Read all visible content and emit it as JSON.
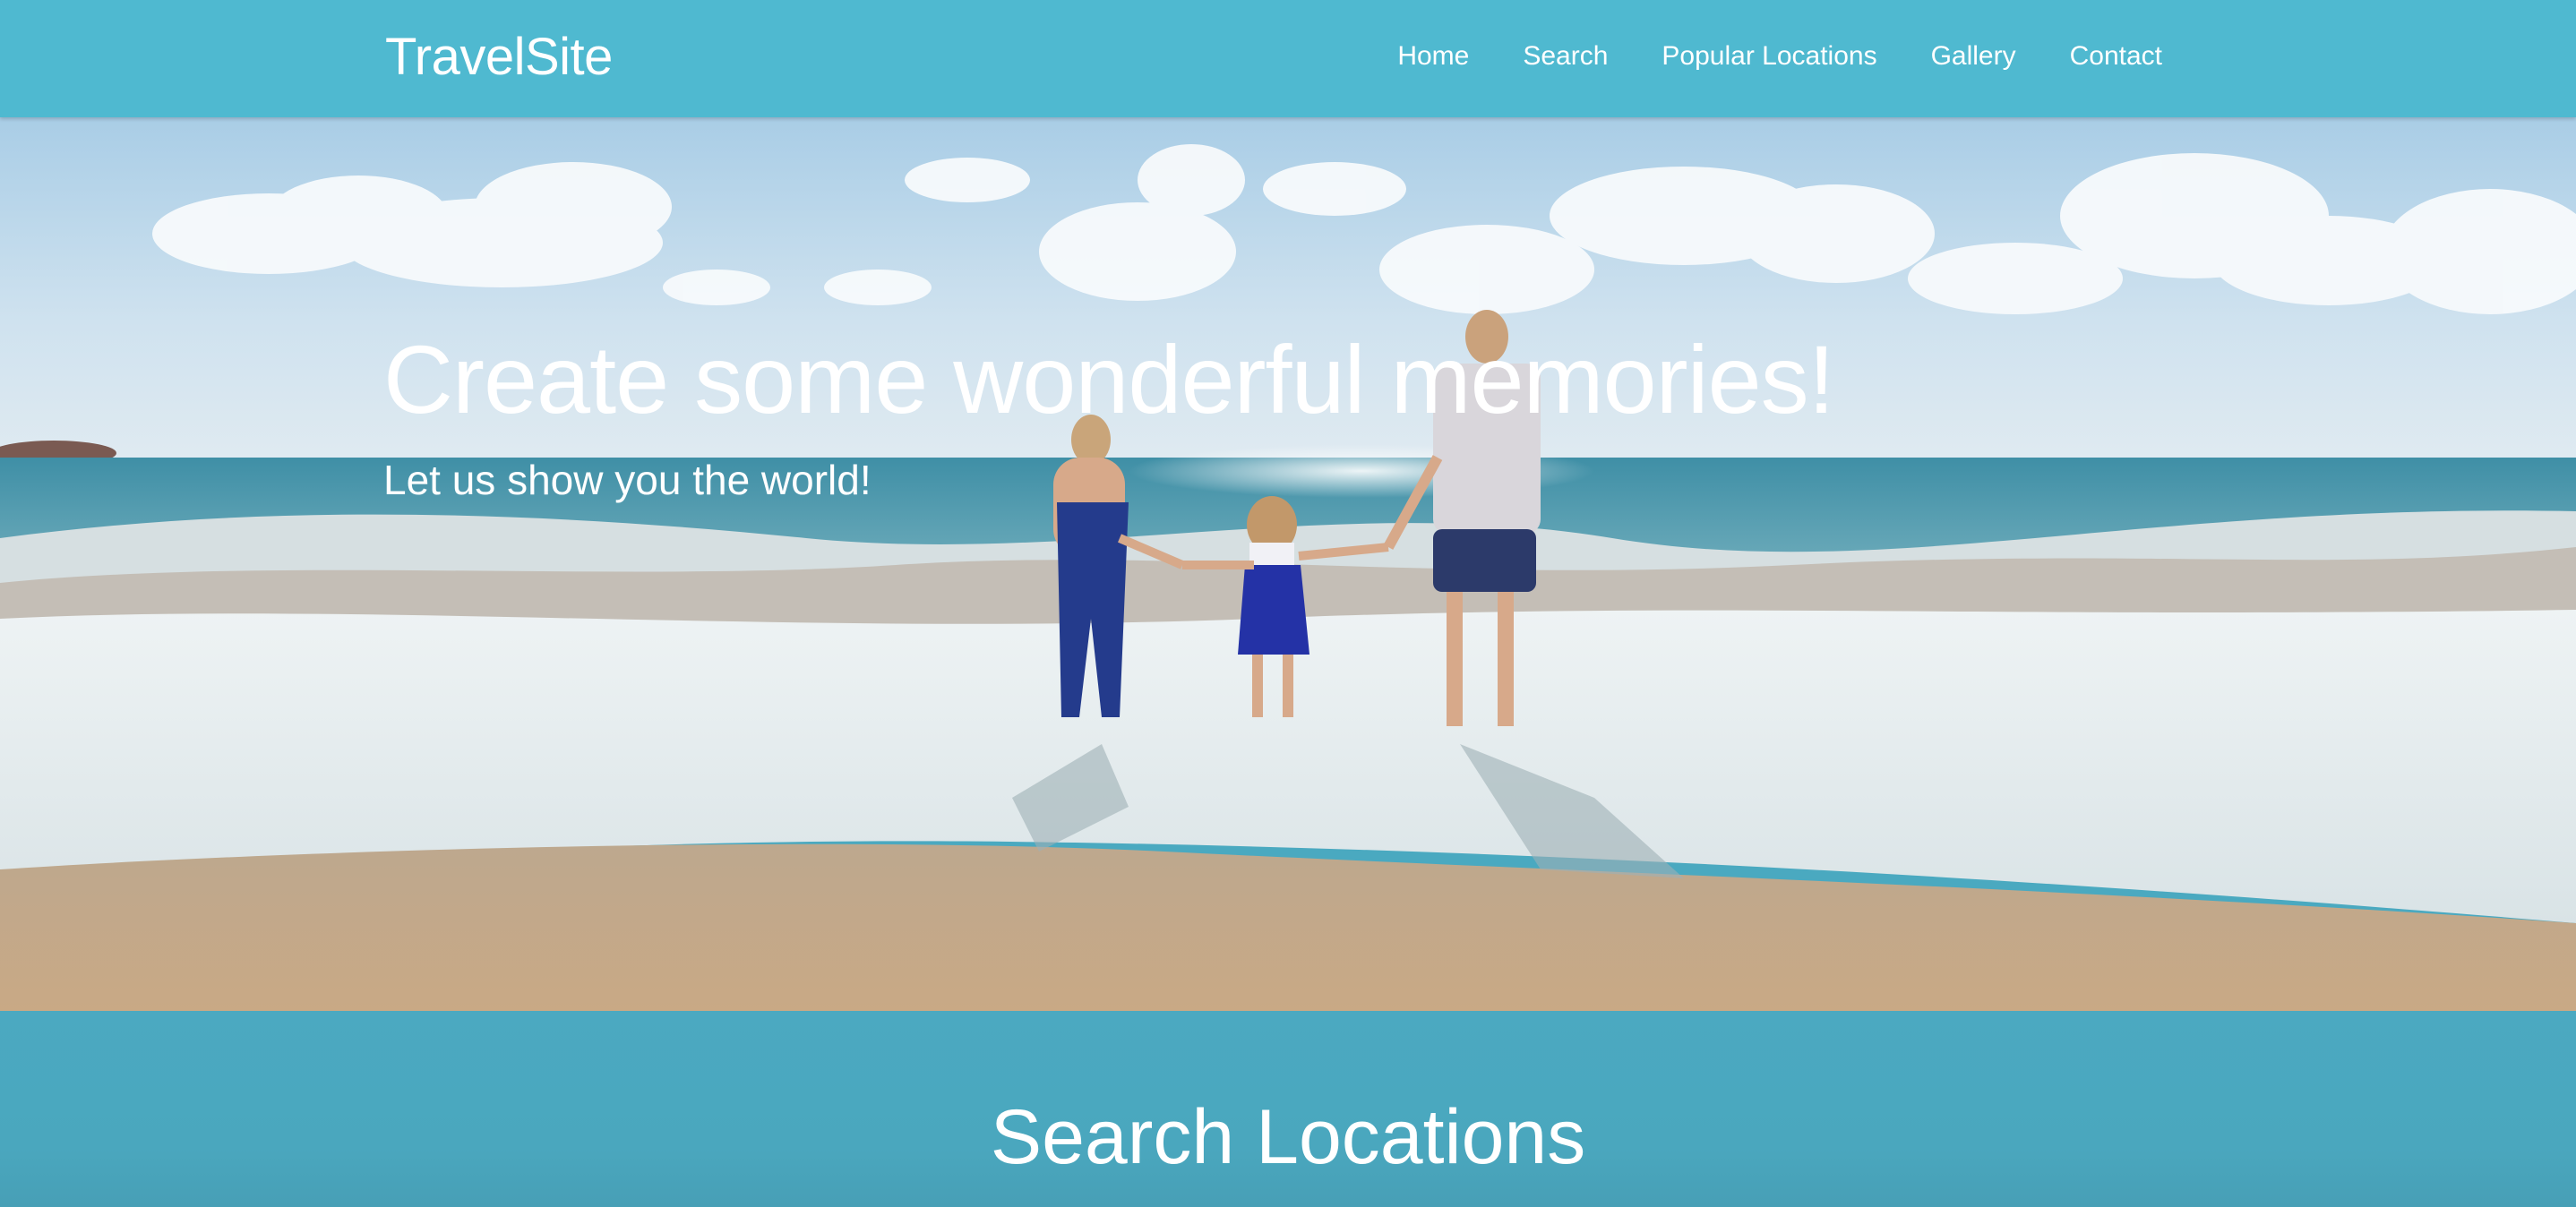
{
  "nav": {
    "brand": "TravelSite",
    "links": [
      "Home",
      "Search",
      "Popular Locations",
      "Gallery",
      "Contact"
    ]
  },
  "hero": {
    "title": "Create some wonderful memories!",
    "subtitle": "Let us show you the world!",
    "image": "family-beach-photo"
  },
  "search_section": {
    "title": "Search Locations"
  },
  "colors": {
    "navbar": "#4fb9d0",
    "section": "#4aa9c0",
    "text": "#ffffff"
  }
}
